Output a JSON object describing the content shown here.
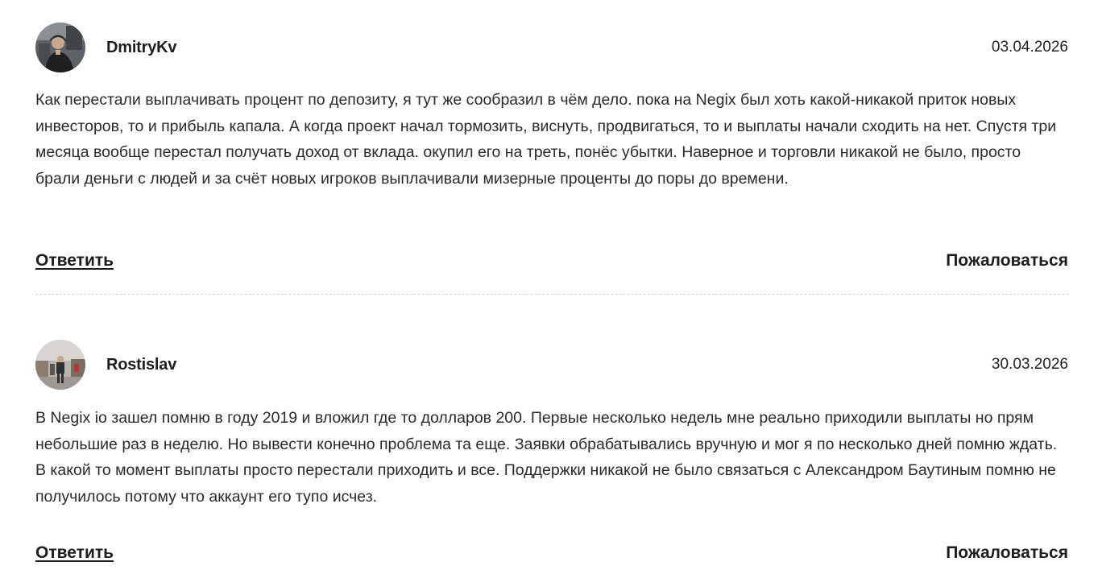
{
  "comments": [
    {
      "author": "DmitryKv",
      "date": "03.04.2026",
      "avatar": "user-photo-avatar",
      "text": "Как перестали выплачивать процент по депозиту, я тут же сообразил в чём дело. пока на Negix был хоть какой-никакой приток новых инвесторов, то и прибыль капала. А когда проект начал тормозить, виснуть, продвигаться, то и выплаты начали сходить на нет. Спустя три месяца вообще перестал получать доход от вклада. окупил его на треть, понёс убытки. Наверное и торговли никакой не было, просто брали деньги с людей и за счёт новых игроков выплачивали мизерные проценты до поры до времени.",
      "reply_label": "Ответить",
      "report_label": "Пожаловаться"
    },
    {
      "author": "Rostislav",
      "date": "30.03.2026",
      "avatar": "user-photo-avatar",
      "text": "В Negix io зашел помню в году 2019 и вложил где то долларов 200. Первые несколько недель мне реально приходили выплаты но прям небольшие раз в неделю. Но вывести конечно проблема та еще. Заявки обрабатывались вручную и мог я по несколько дней помню ждать. В какой то момент выплаты просто перестали приходить и все. Поддержки никакой не было связаться с Александром Баутиным помню не получилось потому что аккаунт его тупо исчез.",
      "reply_label": "Ответить",
      "report_label": "Пожаловаться"
    }
  ]
}
